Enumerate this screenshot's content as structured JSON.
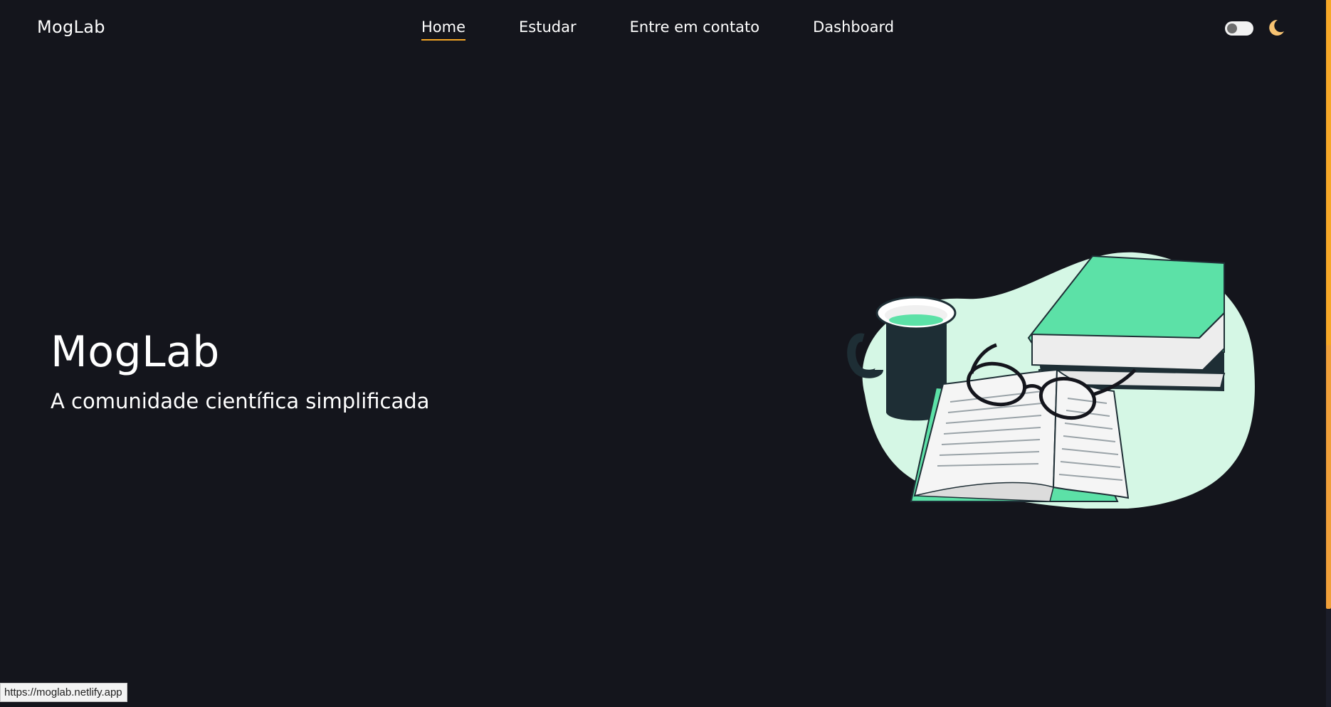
{
  "header": {
    "logo": "MogLab",
    "nav": [
      {
        "label": "Home",
        "active": true
      },
      {
        "label": "Estudar",
        "active": false
      },
      {
        "label": "Entre em contato",
        "active": false
      },
      {
        "label": "Dashboard",
        "active": false
      }
    ],
    "theme_toggle": {
      "state": "off",
      "icon": "moon-icon"
    }
  },
  "hero": {
    "title": "MogLab",
    "subtitle": "A comunidade científica simplificada",
    "illustration": "books-coffee-glasses-illustration"
  },
  "status_bar": {
    "url": "https://moglab.netlify.app"
  },
  "colors": {
    "background": "#14151c",
    "accent": "#f5a524",
    "mint": "#5ce1a7",
    "mint_light": "#d5f7e5",
    "dark_teal": "#1e2e35"
  }
}
